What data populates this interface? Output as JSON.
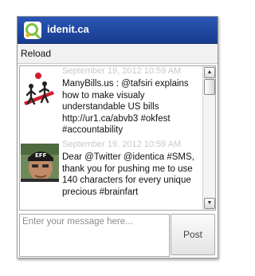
{
  "window": {
    "title": "idenit.ca"
  },
  "toolbar": {
    "reload_label": "Reload"
  },
  "feed": {
    "posts": [
      {
        "time": "September 19, 2012 10:59 AM",
        "text": "ManyBills.us : @tafsiri explains how to make visualy understandable US bills http://ur1.ca/abvb3 #okfest #accountability",
        "avatar": "manybills-logo"
      },
      {
        "time": "September 19, 2012 10:59 AM",
        "text": "Dear @Twitter @identica #SMS, thank you for pushing me to use 140 characters for every unique precious #brainfart",
        "avatar": "user-photo"
      }
    ]
  },
  "composer": {
    "placeholder": "Enter your message here...",
    "value": "",
    "post_label": "Post"
  },
  "colors": {
    "titlebar": "#1f4aa3",
    "timestamp": "#c9c9c9",
    "logo_accent": "#7cc243"
  }
}
